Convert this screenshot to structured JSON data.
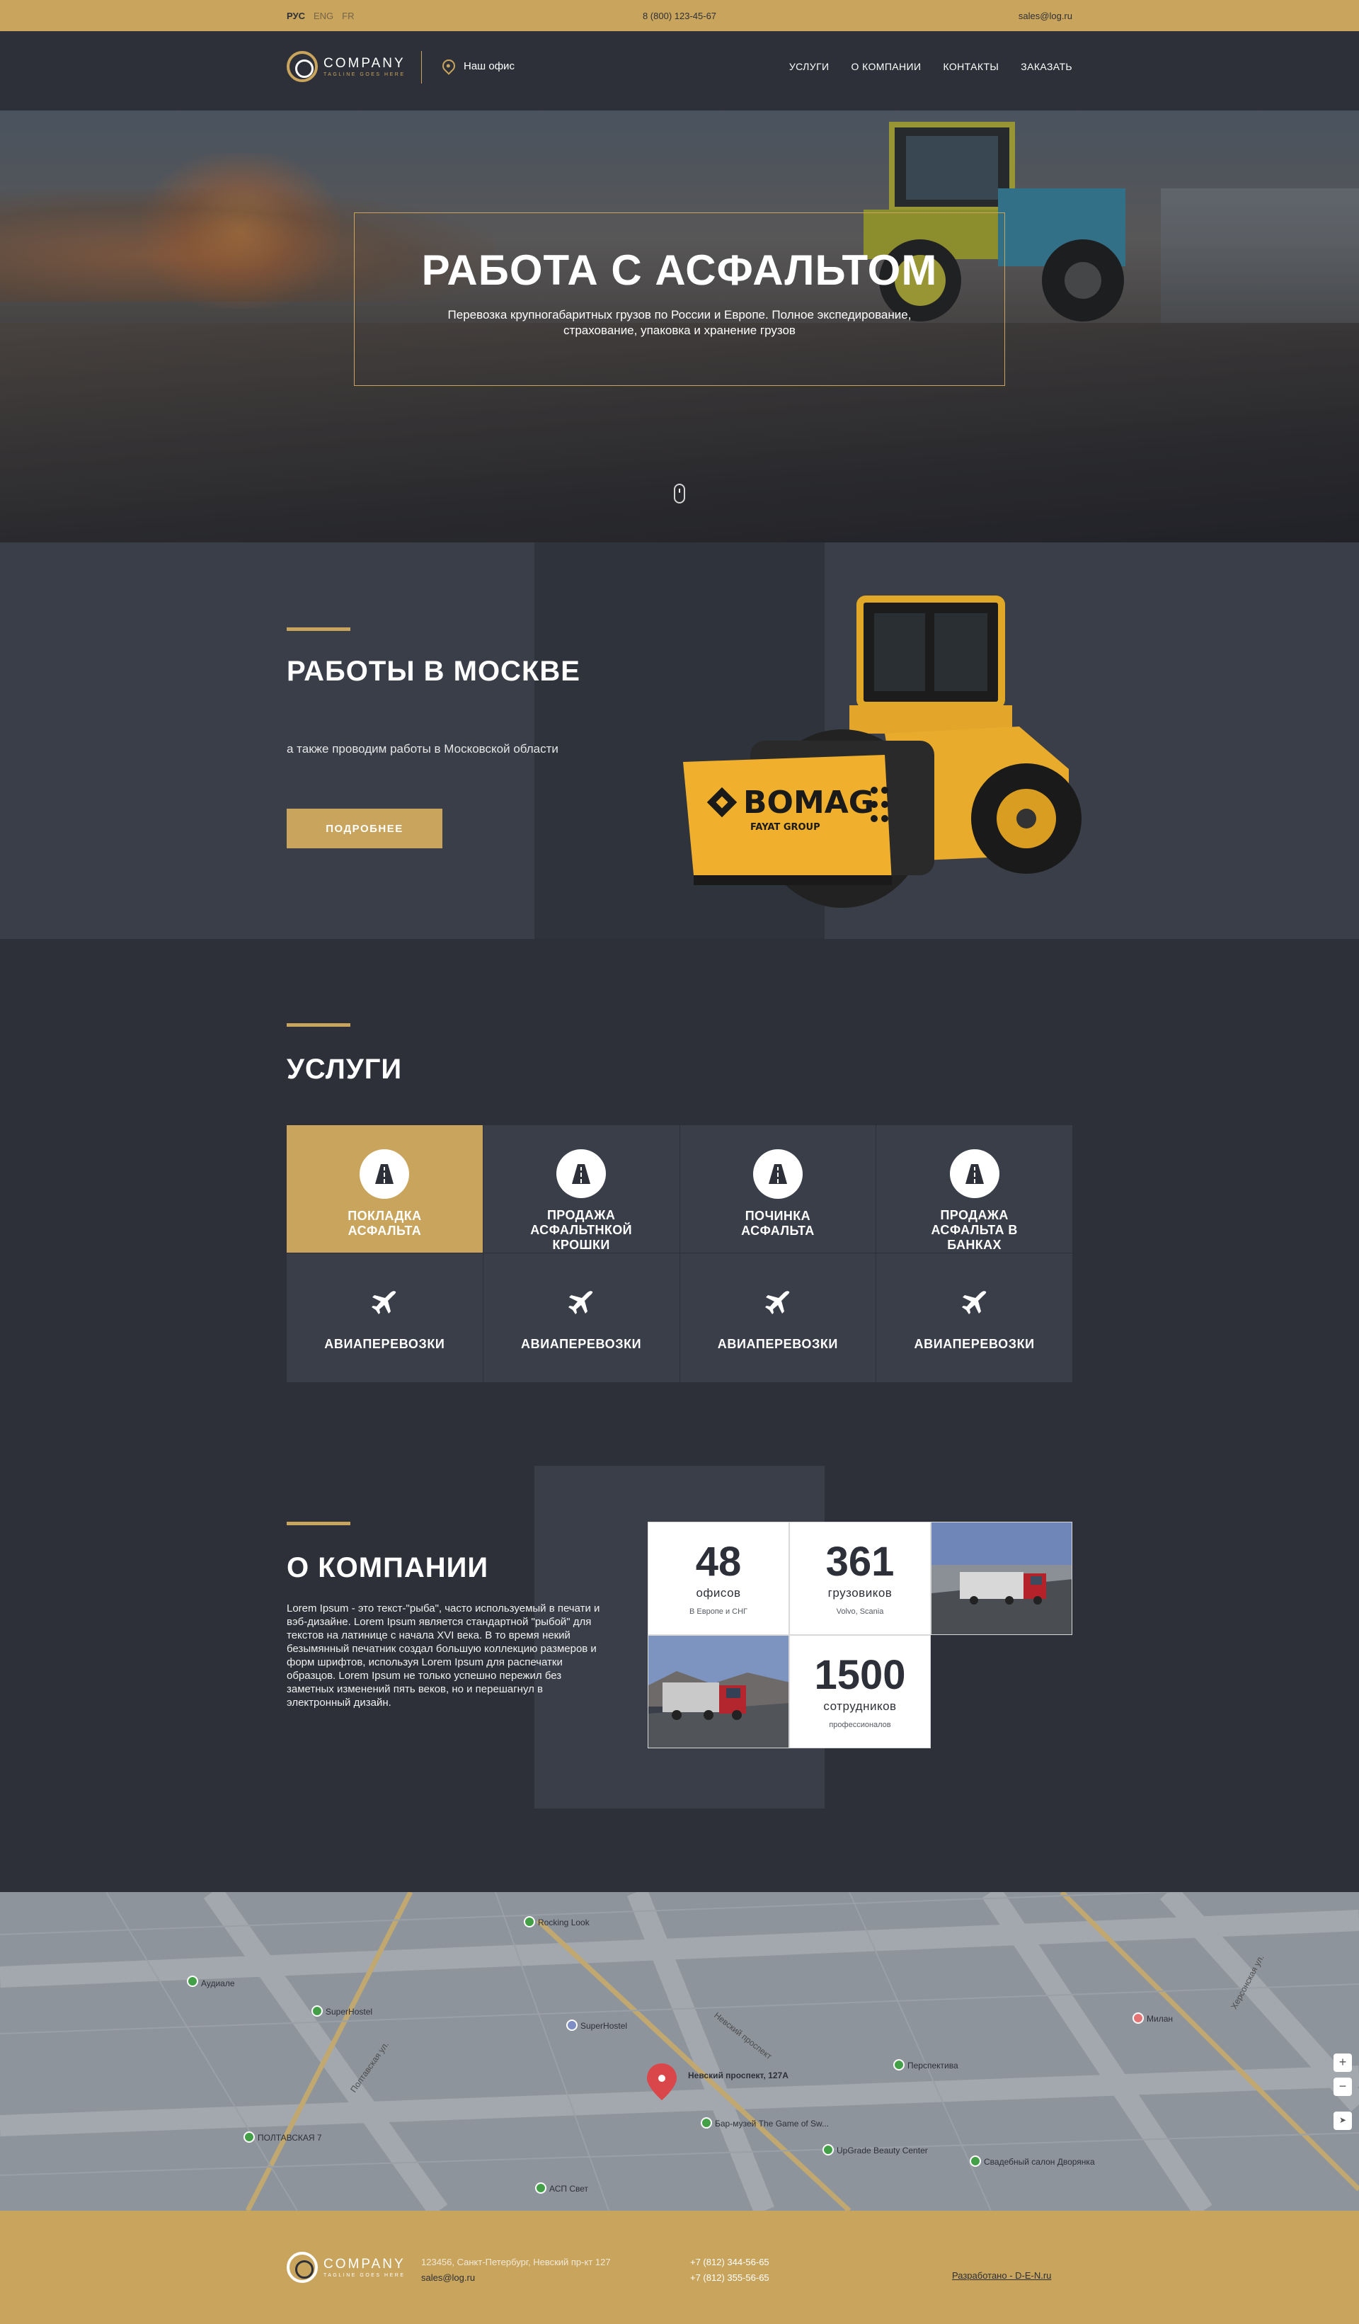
{
  "topbar": {
    "languages": [
      {
        "label": "РУС",
        "active": true
      },
      {
        "label": "ENG",
        "active": false
      },
      {
        "label": "FR",
        "active": false
      }
    ],
    "phone": "8 (800) 123-45-67",
    "email": "sales@log.ru"
  },
  "header": {
    "logo_name": "COMPANY",
    "logo_tagline": "TAGLINE GOES HERE",
    "office_label": "Наш офис",
    "office_icon": "map-pin-icon",
    "nav": [
      "УСЛУГИ",
      "О КОМПАНИИ",
      "КОНТАКТЫ",
      "ЗАКАЗАТЬ"
    ]
  },
  "hero": {
    "title": "РАБОТА С АСФАЛЬТОМ",
    "subtitle": "Перевозка крупногабаритных грузов по России и Европе. Полное экспедирование, страхование, упаковка и хранение грузов",
    "scroll_icon": "mouse-scroll-icon"
  },
  "moscow": {
    "title": "РАБОТЫ В МОСКВЕ",
    "subtitle": "а также проводим работы в Московской области",
    "button": "ПОДРОБНЕЕ",
    "machine_brand": "BOMAG",
    "machine_sub": "FAYAT GROUP"
  },
  "services": {
    "title": "УСЛУГИ",
    "row1": [
      {
        "label": "ПОКЛАДКА АСФАЛЬТА",
        "icon": "road-icon",
        "active": true
      },
      {
        "label": "ПРОДАЖА АСФАЛЬТНКОЙ КРОШКИ",
        "icon": "road-icon",
        "active": false
      },
      {
        "label": "ПОЧИНКА АСФАЛЬТА",
        "icon": "road-icon",
        "active": false
      },
      {
        "label": "ПРОДАЖА АСФАЛЬТА В БАНКАХ",
        "icon": "road-icon",
        "active": false
      }
    ],
    "row2": [
      {
        "label": "АВИАПЕРЕВОЗКИ",
        "icon": "airplane-icon"
      },
      {
        "label": "АВИАПЕРЕВОЗКИ",
        "icon": "airplane-icon"
      },
      {
        "label": "АВИАПЕРЕВОЗКИ",
        "icon": "airplane-icon"
      },
      {
        "label": "АВИАПЕРЕВОЗКИ",
        "icon": "airplane-icon"
      }
    ]
  },
  "about": {
    "title": "О КОМПАНИИ",
    "text": "Lorem Ipsum - это текст-\"рыба\", часто используемый в печати и вэб-дизайне. Lorem Ipsum является стандартной \"рыбой\" для текстов на латинице с начала XVI века. В то время некий безымянный печатник создал большую коллекцию размеров и форм шрифтов, используя Lorem Ipsum для распечатки образцов. Lorem Ipsum не только успешно пережил без заметных изменений пять веков, но и перешагнул в электронный дизайн.",
    "stats": [
      {
        "number": "48",
        "unit": "офисов",
        "desc": "В Европе и СНГ"
      },
      {
        "number": "361",
        "unit": "грузовиков",
        "desc": "Volvo, Scania"
      },
      {
        "number": "1500",
        "unit": "сотрудников",
        "desc": "профессионалов"
      }
    ]
  },
  "map": {
    "marker_label": "Невский проспект, 127А",
    "places": [
      "Rocking Look",
      "SuperHostel",
      "SuperHostel",
      "Аудиале",
      "ПОЛТАВСКАЯ 7",
      "АСП Свет",
      "Бар-музей The Game of Sw...",
      "UpGrade Beauty Center",
      "Свадебный салон Дворянка",
      "Перспектива",
      "Милан"
    ],
    "streets": [
      "Полтавская ул.",
      "Херсонская ул.",
      "Невский проспект"
    ],
    "marker_color": "#d9474b",
    "zoom_in": "+",
    "zoom_out": "−"
  },
  "footer": {
    "logo_name": "COMPANY",
    "logo_tagline": "TAGLINE GOES HERE",
    "address": "123456, Санкт-Петербург, Невский пр-кт 127",
    "email": "sales@log.ru",
    "phone1": "+7 (812) 344-56-65",
    "phone2": "+7 (812) 355-56-65",
    "developer": "Разработано - D-E-N.ru"
  },
  "colors": {
    "accent": "#c9a45c",
    "background": "#2d3038",
    "panel": "#3a3e48"
  }
}
